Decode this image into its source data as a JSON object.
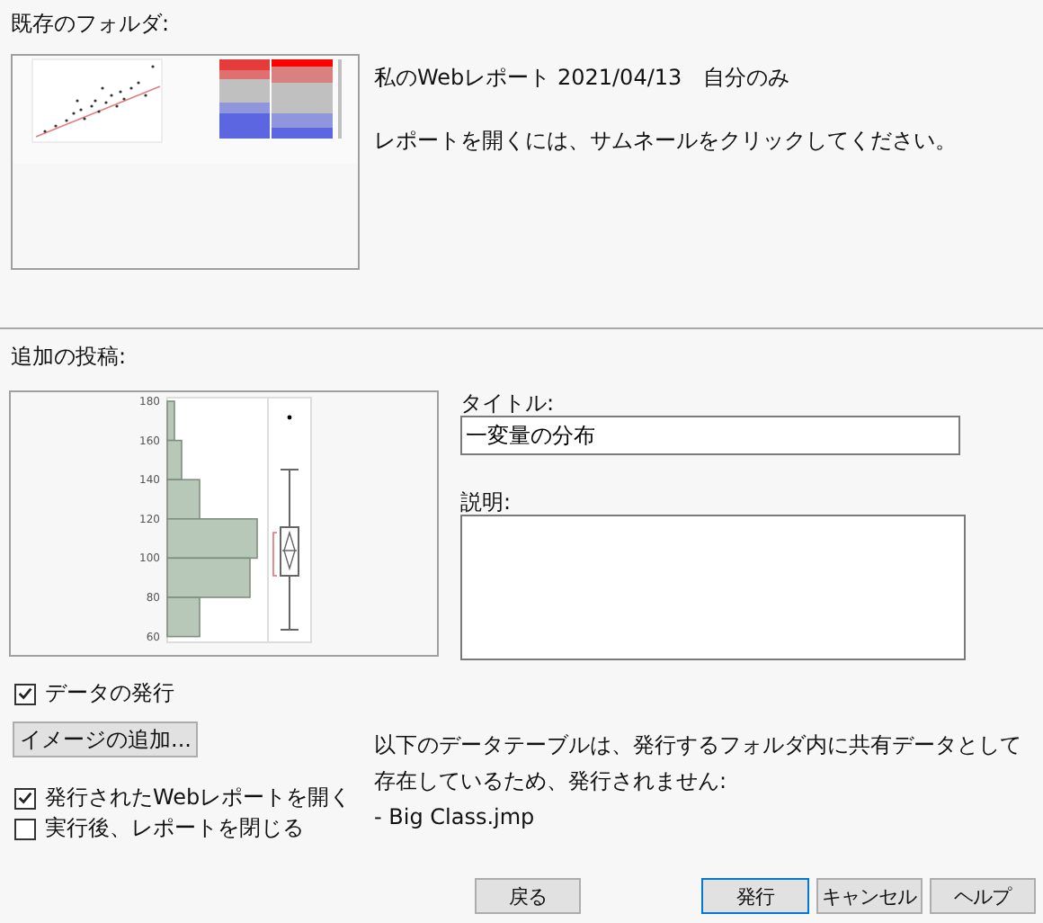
{
  "existing_folder": {
    "label": "既存のフォルダ:",
    "report": "私のWebレポート 2021/04/13　自分のみ",
    "hint": "レポートを開くには、サムネールをクリックしてください。"
  },
  "additional_post": {
    "label": "追加の投稿:",
    "preview": {
      "axis_labels": [
        "180",
        "160",
        "140",
        "120",
        "100",
        "80",
        "60"
      ]
    },
    "title": {
      "label": "タイトル:",
      "value": "一変量の分布"
    },
    "description": {
      "label": "説明:"
    }
  },
  "publish_data": {
    "label": "データの発行",
    "checked": true
  },
  "add_image_button": "イメージの追加...",
  "options": [
    {
      "label": "発行されたWebレポートを開く",
      "checked": true
    },
    {
      "label": "実行後、レポートを閉じる",
      "checked": false
    }
  ],
  "note": {
    "lines": [
      "以下のデータテーブルは、発行するフォルダ内に共有データとして",
      "存在しているため、発行されません:"
    ],
    "files": [
      "- Big Class.jmp"
    ]
  },
  "buttons": [
    {
      "label": "戻る",
      "default": false,
      "kind": "back"
    },
    {
      "label": "発行",
      "default": true,
      "kind": "main"
    },
    {
      "label": "キャンセル",
      "default": false,
      "kind": "main"
    },
    {
      "label": "ヘルプ",
      "default": false,
      "kind": "main"
    }
  ]
}
